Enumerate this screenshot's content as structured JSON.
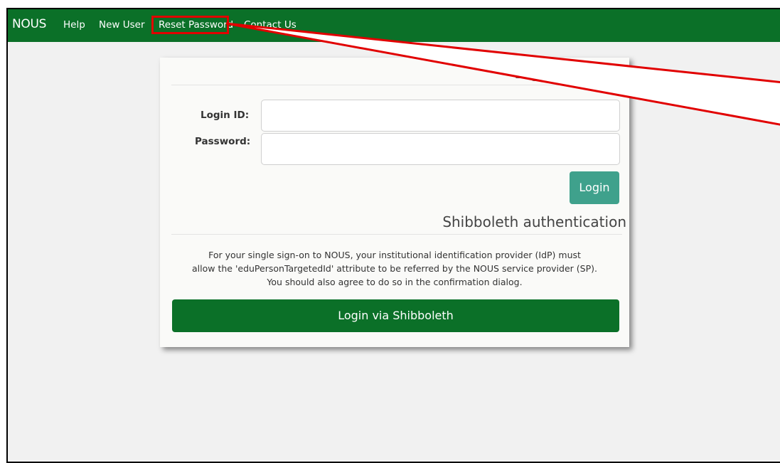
{
  "navbar": {
    "brand": "NOUS",
    "links": [
      "Help",
      "New User",
      "Reset Password",
      "Contact Us"
    ],
    "color": "#0b7028"
  },
  "login_card": {
    "title": "Login with",
    "login_id_label": "Login ID:",
    "login_id_value": "",
    "password_label": "Password:",
    "password_value": "",
    "login_button": "Login",
    "login_button_color": "#3fa18c"
  },
  "shibboleth": {
    "heading": "Shibboleth authentication",
    "notice_lines": [
      "For your single sign-on to NOUS, your institutional identification provider (IdP) must",
      "allow the 'eduPersonTargetedId' attribute to be referred by the NOUS service provider (SP).",
      "You should also agree to do so in the confirmation dialog."
    ],
    "button": "Login via Shibboleth"
  },
  "annotation": {
    "highlight_color": "#e10000",
    "highlighted_item": "Reset Password"
  }
}
